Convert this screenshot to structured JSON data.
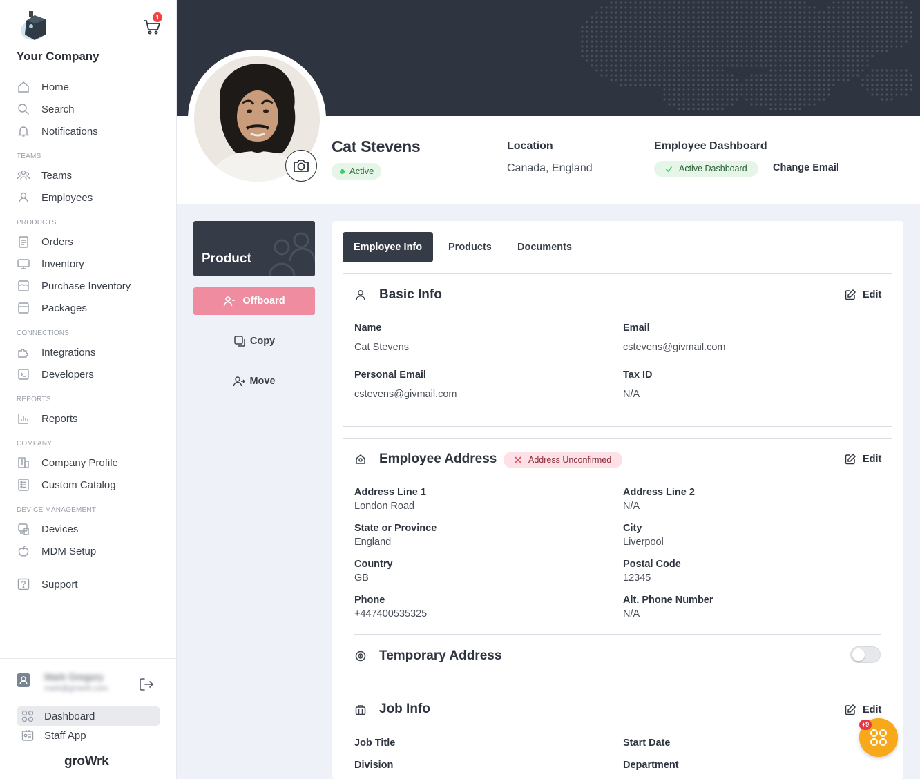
{
  "sidebar": {
    "company_name": "Your Company",
    "cart_count": "1",
    "items": {
      "home": "Home",
      "search": "Search",
      "notifications": "Notifications",
      "teams_section": "TEAMS",
      "teams": "Teams",
      "employees": "Employees",
      "products_section": "PRODUCTS",
      "orders": "Orders",
      "inventory": "Inventory",
      "purchase_inventory": "Purchase Inventory",
      "packages": "Packages",
      "connections_section": "CONNECTIONS",
      "integrations": "Integrations",
      "developers": "Developers",
      "reports_section": "REPORTS",
      "reports": "Reports",
      "company_section": "COMPANY",
      "company_profile": "Company Profile",
      "custom_catalog": "Custom Catalog",
      "device_section": "DEVICE MANAGEMENT",
      "devices": "Devices",
      "mdm_setup": "MDM Setup",
      "support": "Support"
    },
    "user": {
      "name": "Mark Gregory",
      "email": "mark@growrk.com"
    },
    "dashboard": "Dashboard",
    "staff_app": "Staff App",
    "brand": "groWrk"
  },
  "profile": {
    "name": "Cat Stevens",
    "status": "Active",
    "location_label": "Location",
    "location_value": "Canada, England",
    "dashboard_label": "Employee Dashboard",
    "dashboard_status": "Active Dashboard",
    "change_email": "Change Email"
  },
  "actions": {
    "product_card": "Product",
    "offboard": "Offboard",
    "copy": "Copy",
    "move": "Move"
  },
  "tabs": [
    "Employee Info",
    "Products",
    "Documents"
  ],
  "basic_info": {
    "title": "Basic Info",
    "edit": "Edit",
    "name_label": "Name",
    "name_value": "Cat Stevens",
    "email_label": "Email",
    "email_value": "cstevens@givmail.com",
    "personal_email_label": "Personal Email",
    "personal_email_value": "cstevens@givmail.com",
    "tax_id_label": "Tax ID",
    "tax_id_value": "N/A"
  },
  "address": {
    "title": "Employee Address",
    "badge": "Address Unconfirmed",
    "edit": "Edit",
    "line1_label": "Address Line 1",
    "line1_value": "London Road",
    "line2_label": "Address Line 2",
    "line2_value": "N/A",
    "state_label": "State or Province",
    "state_value": "England",
    "city_label": "City",
    "city_value": "Liverpool",
    "country_label": "Country",
    "country_value": "GB",
    "postal_label": "Postal Code",
    "postal_value": "12345",
    "phone_label": "Phone",
    "phone_value": "+447400535325",
    "alt_phone_label": "Alt. Phone Number",
    "alt_phone_value": "N/A",
    "temp_title": "Temporary Address",
    "temp_enabled": false
  },
  "job_info": {
    "title": "Job Info",
    "edit": "Edit",
    "job_title_label": "Job Title",
    "start_date_label": "Start Date",
    "division_label": "Division",
    "department_label": "Department"
  },
  "fab": {
    "badge": "+9"
  },
  "colors": {
    "banner": "#2f3540",
    "offboard": "#f08c9f",
    "active_badge": "#e5f6e8",
    "unconfirmed_badge": "#fde1e6",
    "fab": "#f7a81b"
  }
}
